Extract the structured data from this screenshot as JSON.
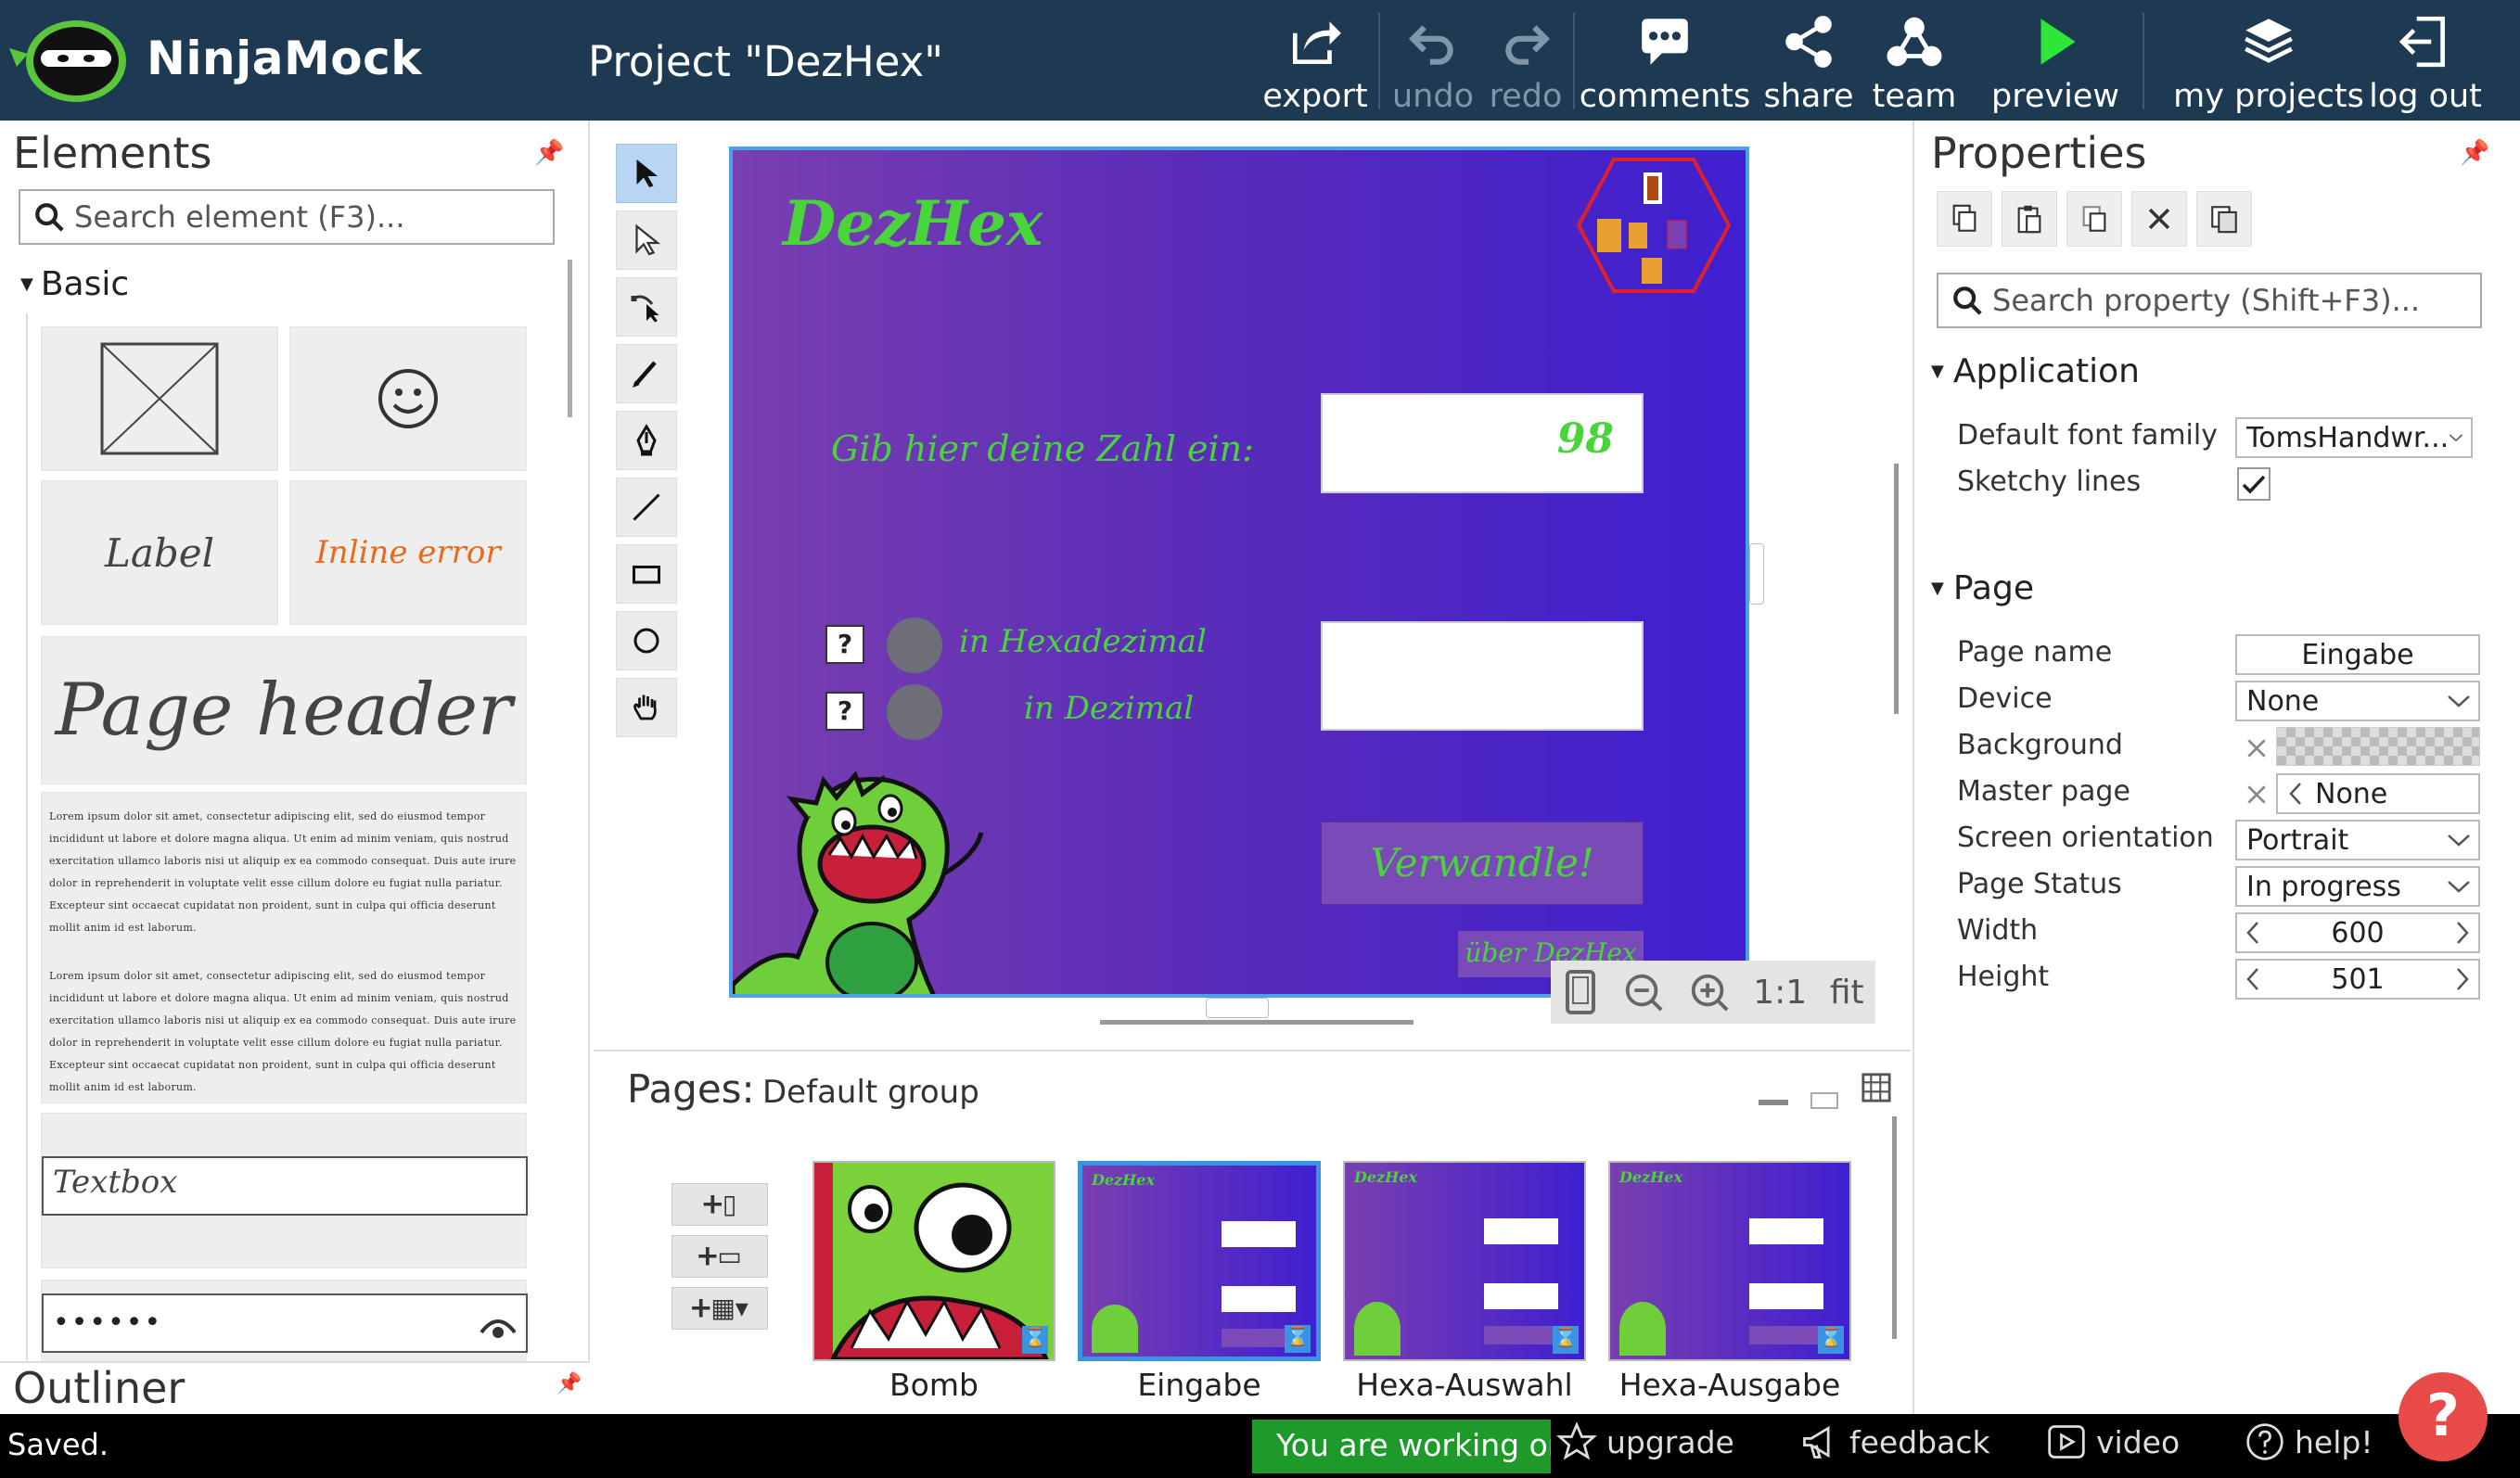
{
  "app": {
    "name": "NinjaMock",
    "project_title": "Project \"DezHex\""
  },
  "toolbar": {
    "export": "export",
    "undo": "undo",
    "redo": "redo",
    "comments": "comments",
    "share": "share",
    "team": "team",
    "preview": "preview",
    "my_projects": "my projects",
    "log_out": "log out"
  },
  "elements_panel": {
    "title": "Elements",
    "search_placeholder": "Search element (F3)...",
    "group": "Basic",
    "tiles": {
      "label": "Label",
      "inline_error": "Inline error",
      "page_header": "Page header",
      "textbox": "Textbox",
      "password": "••••••"
    },
    "lorem": "Lorem ipsum dolor sit amet, consectetur adipiscing elit, sed do eiusmod tempor incididunt ut labore et dolore magna aliqua. Ut enim ad minim veniam, quis nostrud exercitation ullamco laboris nisi ut aliquip ex ea commodo consequat. Duis aute irure dolor in reprehenderit in voluptate velit esse cillum dolore eu fugiat nulla pariatur. Excepteur sint occaecat cupidatat non proident, sunt in culpa qui officia deserunt mollit anim id est laborum."
  },
  "outliner": {
    "title": "Outliner"
  },
  "mockup": {
    "logo": "DezHex",
    "prompt": "Gib hier deine Zahl ein:",
    "input_value": "98",
    "radio1": "in Hexadezimal",
    "radio2": "in Dezimal",
    "help_mark": "?",
    "convert_button": "Verwandle!",
    "about_link": "über DezHex",
    "badge_letters": "DezHex"
  },
  "zoom": {
    "one_to_one": "1:1",
    "fit": "fit"
  },
  "pages": {
    "title": "Pages:",
    "group": "Default group",
    "items": [
      {
        "label": "Bomb"
      },
      {
        "label": "Eingabe"
      },
      {
        "label": "Hexa-Auswahl"
      },
      {
        "label": "Hexa-Ausgabe"
      }
    ]
  },
  "properties": {
    "title": "Properties",
    "search_placeholder": "Search property (Shift+F3)...",
    "application": {
      "title": "Application",
      "default_font_family_label": "Default font family",
      "default_font_family_value": "TomsHandwr...",
      "sketchy_lines_label": "Sketchy lines",
      "sketchy_lines_checked": true
    },
    "page": {
      "title": "Page",
      "page_name_label": "Page name",
      "page_name_value": "Eingabe",
      "device_label": "Device",
      "device_value": "None",
      "background_label": "Background",
      "master_page_label": "Master page",
      "master_page_value": "None",
      "screen_orientation_label": "Screen orientation",
      "screen_orientation_value": "Portrait",
      "page_status_label": "Page Status",
      "page_status_value": "In progress",
      "width_label": "Width",
      "width_value": "600",
      "height_label": "Height",
      "height_value": "501"
    }
  },
  "statusbar": {
    "saved": "Saved.",
    "online_notice": "You are working onl",
    "upgrade": "upgrade",
    "feedback": "feedback",
    "video": "video",
    "help": "help!"
  },
  "colors": {
    "topbar": "#1d3a52",
    "accent": "#3b93e3",
    "mock_green": "#4ad43c",
    "preview_green": "#2ee53a",
    "status_green": "#1d9a2a",
    "help_red": "#e84a4a"
  }
}
